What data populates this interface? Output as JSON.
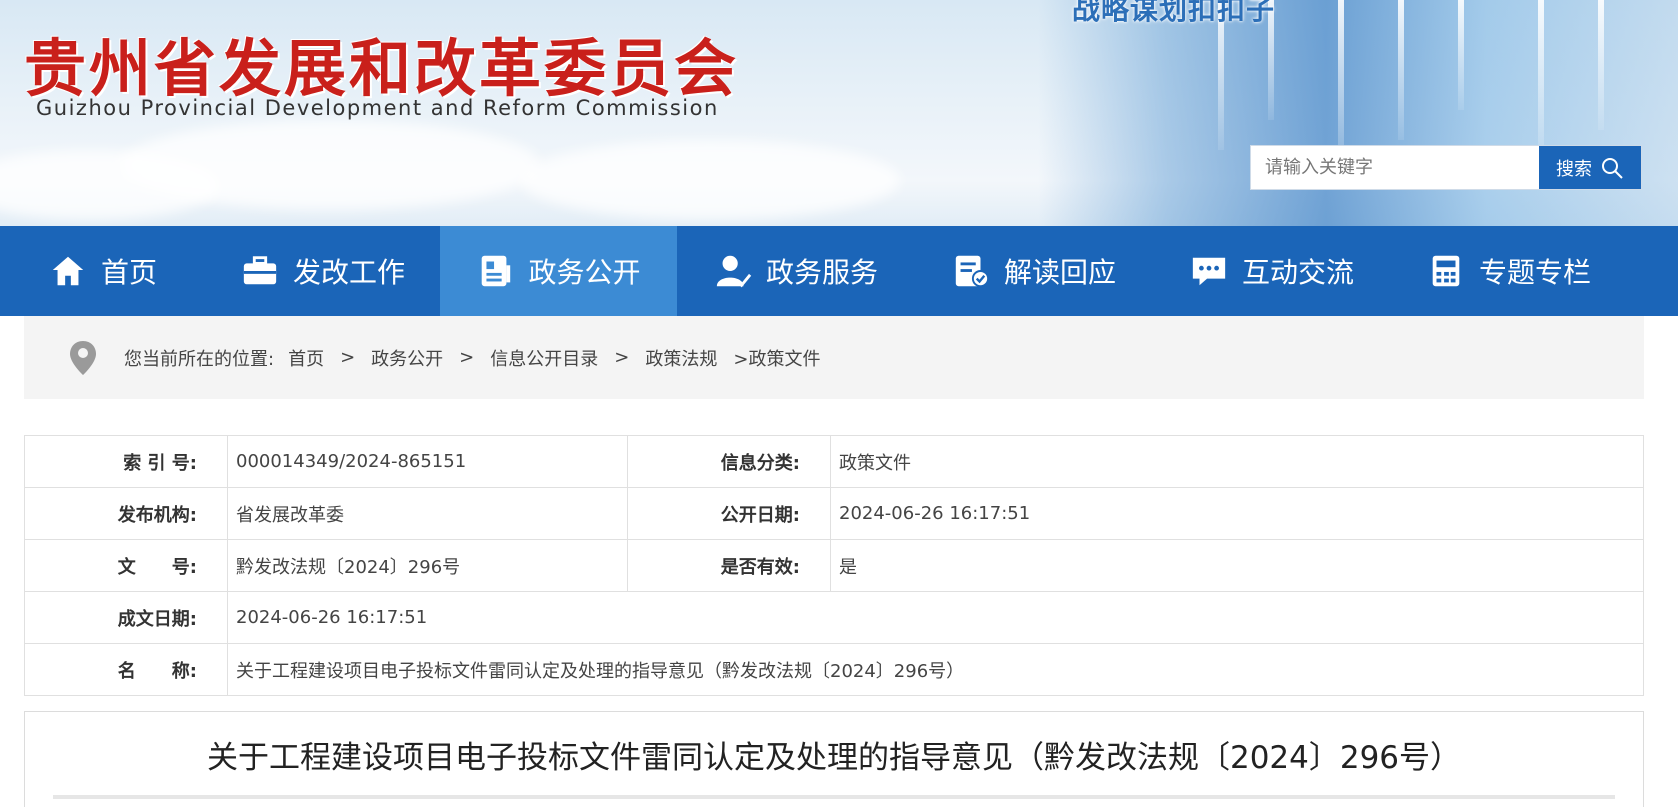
{
  "header": {
    "org_name_cn": "贵州省发展和改革委员会",
    "org_name_en": "Guizhou Provincial Development and Reform Commission",
    "slogan": "战略谋划扣扣子",
    "search": {
      "placeholder": "请输入关键字",
      "button_label": "搜索"
    }
  },
  "nav": {
    "items": [
      {
        "label": "首页",
        "icon": "home-icon"
      },
      {
        "label": "发改工作",
        "icon": "briefcase-icon"
      },
      {
        "label": "政务公开",
        "icon": "id-card-icon",
        "active": true
      },
      {
        "label": "政务服务",
        "icon": "user-service-icon"
      },
      {
        "label": "解读回应",
        "icon": "doc-check-icon"
      },
      {
        "label": "互动交流",
        "icon": "chat-icon"
      },
      {
        "label": "专题专栏",
        "icon": "calculator-icon"
      }
    ]
  },
  "breadcrumb": {
    "prefix": "您当前所在的位置:",
    "items": [
      "首页",
      "政务公开",
      "信息公开目录",
      "政策法规"
    ],
    "current": ">政策文件",
    "separator": ">"
  },
  "info": {
    "index_label": "索 引 号:",
    "index_value": "000014349/2024-865151",
    "category_label": "信息分类:",
    "category_value": "政策文件",
    "issuer_label": "发布机构:",
    "issuer_value": "省发展改革委",
    "publish_date_label": "公开日期:",
    "publish_date_value": "2024-06-26 16:17:51",
    "doc_no_label": "文　　号:",
    "doc_no_value": "黔发改法规〔2024〕296号",
    "valid_label": "是否有效:",
    "valid_value": "是",
    "created_label": "成文日期:",
    "created_value": "2024-06-26 16:17:51",
    "name_label": "名　　称:",
    "name_value": "关于工程建设项目电子投标文件雷同认定及处理的指导意见（黔发改法规〔2024〕296号）"
  },
  "article": {
    "title": "关于工程建设项目电子投标文件雷同认定及处理的指导意见（黔发改法规〔2024〕296号）"
  },
  "colors": {
    "brand_blue": "#1b65b8",
    "active_nav": "#3c8bd4",
    "logo_red": "#c9201b"
  }
}
